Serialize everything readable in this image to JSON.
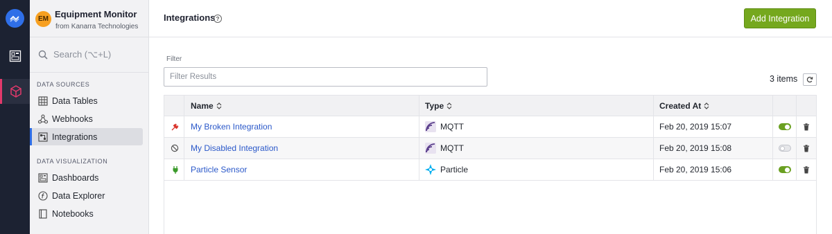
{
  "app": {
    "org_initials": "EM",
    "org_name": "Equipment Monitor",
    "org_sub": "from Kanarra Technologies"
  },
  "search": {
    "placeholder": "Search (⌥+L)"
  },
  "sidebar": {
    "sections": [
      {
        "label": "DATA SOURCES"
      },
      {
        "label": "DATA VISUALIZATION"
      }
    ],
    "items": [
      {
        "label": "Data Tables",
        "icon": "table-icon"
      },
      {
        "label": "Webhooks",
        "icon": "webhook-icon"
      },
      {
        "label": "Integrations",
        "icon": "integrations-icon",
        "active": true
      },
      {
        "label": "Dashboards",
        "icon": "dashboard-icon"
      },
      {
        "label": "Data Explorer",
        "icon": "function-icon"
      },
      {
        "label": "Notebooks",
        "icon": "notebook-icon"
      }
    ]
  },
  "header": {
    "title": "Integrations",
    "help_glyph": "?",
    "add_button": "Add Integration"
  },
  "filter": {
    "label": "Filter",
    "placeholder": "Filter Results"
  },
  "items_count": "3 items",
  "table": {
    "columns": [
      "Name",
      "Type",
      "Created At"
    ],
    "rows": [
      {
        "status_icon": "broken-plug-icon",
        "name": "My Broken Integration",
        "type": "MQTT",
        "type_icon": "mqtt-icon",
        "created": "Feb 20, 2019 15:07",
        "enabled": true
      },
      {
        "status_icon": "disabled-icon",
        "name": "My Disabled Integration",
        "type": "MQTT",
        "type_icon": "mqtt-icon",
        "created": "Feb 20, 2019 15:08",
        "enabled": false
      },
      {
        "status_icon": "connected-plug-icon",
        "name": "Particle Sensor",
        "type": "Particle",
        "type_icon": "particle-icon",
        "created": "Feb 20, 2019 15:06",
        "enabled": true
      }
    ]
  },
  "colors": {
    "accent": "#2f6fe8",
    "add_button": "#75a81e",
    "rail": "#1c2232",
    "link": "#2a58c9",
    "toggle_on": "#6aa021",
    "broken": "#d9342b",
    "connected": "#3a9a2a"
  }
}
